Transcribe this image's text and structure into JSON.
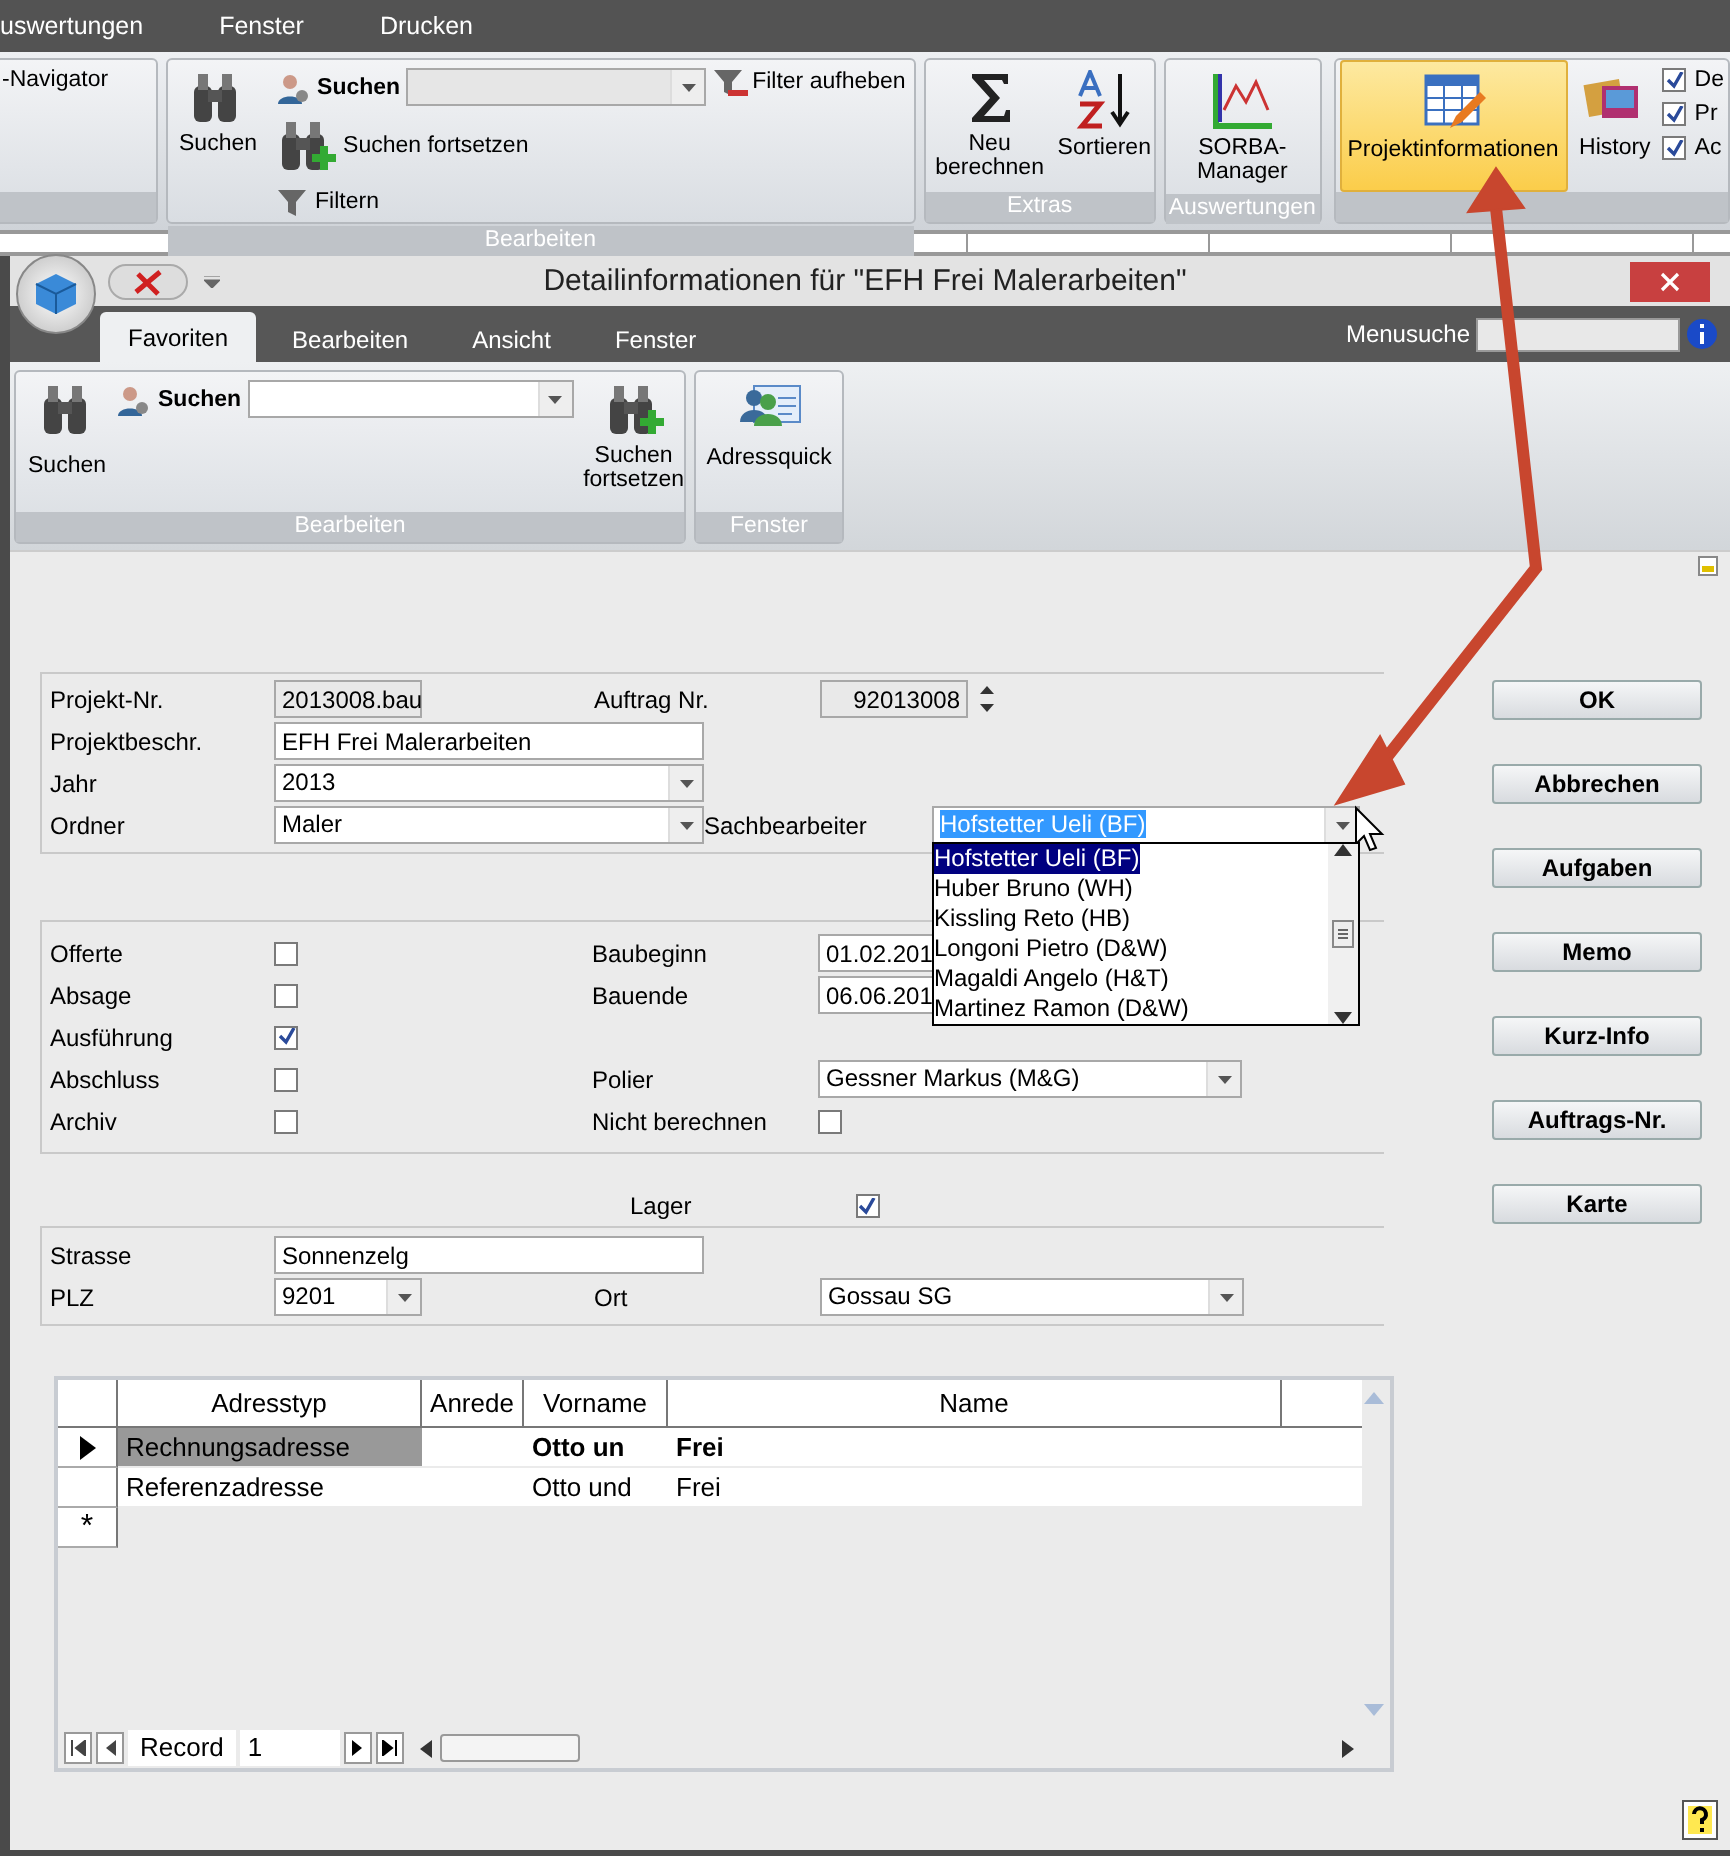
{
  "app_menu": [
    "uswertungen",
    "Fenster",
    "Drucken"
  ],
  "app_ribbon": {
    "navigator": "-Navigator",
    "bearbeiten": {
      "search_button": "Suchen",
      "search_label": "Suchen",
      "search_next": "Suchen fortsetzen",
      "filter": "Filtern",
      "filter_clear": "Filter aufheben",
      "caption": "Bearbeiten"
    },
    "extras": {
      "recalc": "Neu berechnen",
      "sort": "Sortieren",
      "caption": "Extras"
    },
    "auswertungen": {
      "manager": "SORBA-Manager",
      "caption": "Auswertungen"
    },
    "projekt": {
      "label": "Projektinformationen",
      "highlighted": true
    },
    "history": "History",
    "options": [
      {
        "label": "De",
        "checked": true
      },
      {
        "label": "Pr",
        "checked": true
      },
      {
        "label": "Ac",
        "checked": true
      }
    ]
  },
  "dialog": {
    "title": "Detailinformationen für \"EFH Frei Malerarbeiten\"",
    "tabs": [
      {
        "label": "Favoriten",
        "selected": true
      },
      {
        "label": "Bearbeiten",
        "selected": false
      },
      {
        "label": "Ansicht",
        "selected": false
      },
      {
        "label": "Fenster",
        "selected": false
      }
    ],
    "menu_search_label": "Menusuche",
    "ribbon": {
      "search_button": "Suchen",
      "search_label": "Suchen",
      "search_next": "Suchen fortsetzen",
      "caption": "Bearbeiten",
      "adressquick": "Adressquick",
      "caption2": "Fenster"
    }
  },
  "head": {
    "projekt_nr": {
      "label": "Projekt-Nr.",
      "value": "2013008.bau"
    },
    "auftrag_nr": {
      "label": "Auftrag Nr.",
      "value": "92013008"
    },
    "beschreibung": {
      "label": "Projektbeschr.",
      "value": "EFH Frei Malerarbeiten"
    },
    "jahr": {
      "label": "Jahr",
      "value": "2013"
    },
    "ordner": {
      "label": "Ordner",
      "value": "Maler"
    },
    "sachbearbeiter": {
      "label": "Sachbearbeiter",
      "value": "Hofstetter Ueli (BF)",
      "expanded": true,
      "options": [
        {
          "label": "Hofstetter Ueli (BF)",
          "selected": true
        },
        {
          "label": "Huber Bruno (WH)",
          "selected": false
        },
        {
          "label": "Kissling Reto (HB)",
          "selected": false
        },
        {
          "label": "Longoni Pietro (D&W)",
          "selected": false
        },
        {
          "label": "Magaldi Angelo (H&T)",
          "selected": false
        },
        {
          "label": "Martinez Ramon (D&W)",
          "selected": false
        }
      ]
    }
  },
  "status": {
    "checks": [
      {
        "label": "Offerte",
        "checked": false
      },
      {
        "label": "Absage",
        "checked": false
      },
      {
        "label": "Ausführung",
        "checked": true
      },
      {
        "label": "Abschluss",
        "checked": false
      },
      {
        "label": "Archiv",
        "checked": false
      }
    ],
    "baubeginn": {
      "label": "Baubeginn",
      "value": "01.02.201"
    },
    "bauende": {
      "label": "Bauende",
      "value": "06.06.201"
    },
    "polier": {
      "label": "Polier",
      "value": "Gessner Markus (M&G)"
    },
    "nicht_berechnen": {
      "label": "Nicht berechnen",
      "checked": false
    }
  },
  "lager": {
    "label": "Lager",
    "checked": true
  },
  "address": {
    "strasse": {
      "label": "Strasse",
      "value": "Sonnenzelg"
    },
    "plz": {
      "label": "PLZ",
      "value": "9201"
    },
    "ort": {
      "label": "Ort",
      "value": "Gossau SG"
    }
  },
  "grid": {
    "columns": [
      "Adresstyp",
      "Anrede",
      "Vorname",
      "Name"
    ],
    "rows": [
      {
        "adresstyp": "Rechnungsadresse",
        "vorname": "Otto un",
        "name": "Frei",
        "selected": true
      },
      {
        "adresstyp": "Referenzadresse",
        "vorname": "Otto und",
        "name": "Frei",
        "selected": false
      }
    ],
    "new_row_marker": "*",
    "nav": {
      "label": "Record",
      "value": "1"
    }
  },
  "buttons": [
    "OK",
    "Abbrechen",
    "Aufgaben",
    "Memo",
    "Kurz-Info",
    "Auftrags-Nr.",
    "Karte"
  ]
}
